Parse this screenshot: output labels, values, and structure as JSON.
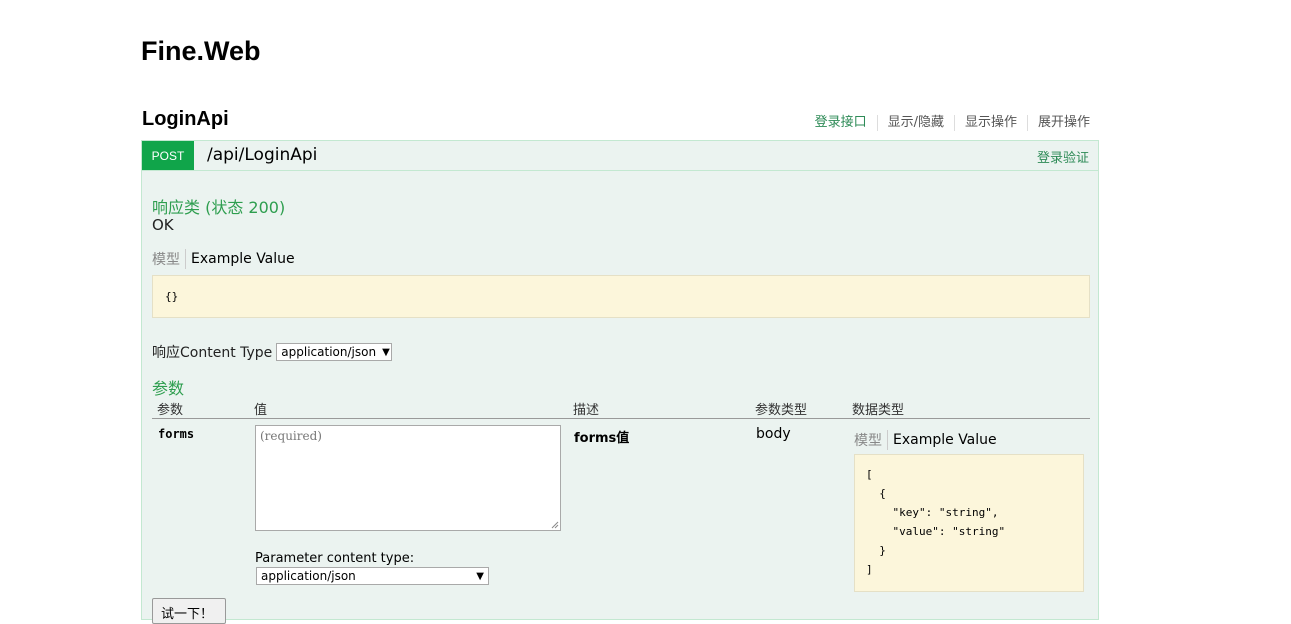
{
  "app": {
    "title": "Fine.Web"
  },
  "resource": {
    "name": "LoginApi",
    "links": [
      "登录接口",
      "显示/隐藏",
      "显示操作",
      "展开操作"
    ]
  },
  "operation": {
    "method": "POST",
    "path": "/api/LoginApi",
    "summary": "登录验证",
    "response": {
      "heading": "响应类 (状态 200)",
      "status_text": "OK",
      "tab_model": "模型",
      "tab_example": "Example Value",
      "example": "{}"
    },
    "content_type": {
      "label": "响应Content Type",
      "selected": "application/json"
    },
    "parameters": {
      "heading": "参数",
      "columns": [
        "参数",
        "值",
        "描述",
        "参数类型",
        "数据类型"
      ],
      "rows": [
        {
          "name": "forms",
          "placeholder": "(required)",
          "description": "forms值",
          "param_type": "body",
          "tab_model": "模型",
          "tab_example": "Example Value",
          "example": "[\n  {\n    \"key\": \"string\",\n    \"value\": \"string\"\n  }\n]",
          "content_type_label": "Parameter content type:",
          "content_type_selected": "application/json"
        }
      ]
    },
    "try_button": "试一下！"
  },
  "colors": {
    "accent": "#10a54a",
    "panel_bg": "#ebf3f0",
    "snippet_bg": "#fcf6db"
  }
}
